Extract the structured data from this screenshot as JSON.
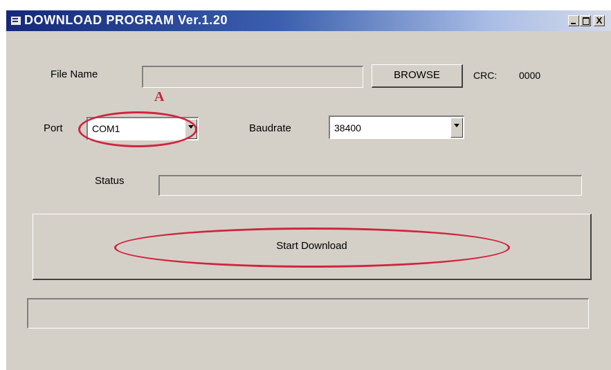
{
  "window": {
    "title": "DOWNLOAD PROGRAM Ver.1.20",
    "controls": [
      "minimize",
      "maximize",
      "close"
    ],
    "close_glyph": "X"
  },
  "form": {
    "file_name_label": "File Name",
    "file_name_value": "",
    "browse_label": "BROWSE",
    "crc_label": "CRC:",
    "crc_value": "0000",
    "port_label": "Port",
    "port_value": "COM1",
    "baudrate_label": "Baudrate",
    "baudrate_value": "38400",
    "status_label": "Status",
    "status_value": "",
    "start_label": "Start Download",
    "progress_value": ""
  },
  "annotations": {
    "callout_letter": "A",
    "accent_color": "#d0243f"
  },
  "colors": {
    "window_bg": "#d4d0c8",
    "title_gradient_start": "#14287a",
    "title_gradient_end": "#d4dbe9"
  }
}
